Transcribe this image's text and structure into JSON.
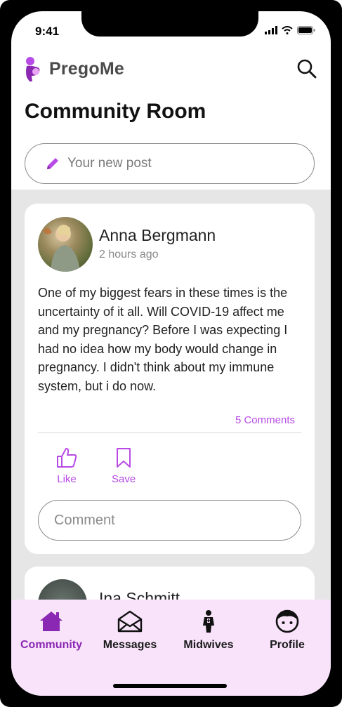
{
  "status_bar": {
    "time": "9:41"
  },
  "app": {
    "name": "PregoMe"
  },
  "page": {
    "title": "Community Room"
  },
  "composer": {
    "placeholder": "Your new post"
  },
  "posts": [
    {
      "author": "Anna Bergmann",
      "time": "2 hours ago",
      "body": "One of my biggest fears in these times is the uncertainty of it all. Will COVID-19 affect me and my pregnancy? Before I was expecting I had no idea how my body would change in pregnancy. I didn't think about my immune system, but i do now.",
      "comments": "5 Comments",
      "like_label": "Like",
      "save_label": "Save",
      "comment_placeholder": "Comment"
    },
    {
      "author": "Ina Schmitt"
    }
  ],
  "tabs": [
    {
      "label": "Community",
      "icon": "home-icon",
      "active": true
    },
    {
      "label": "Messages",
      "icon": "envelope-icon",
      "active": false
    },
    {
      "label": "Midwives",
      "icon": "midwife-icon",
      "active": false
    },
    {
      "label": "Profile",
      "icon": "face-icon",
      "active": false
    }
  ],
  "colors": {
    "accent": "#b84be6",
    "active_tab": "#8a27b3",
    "tabbar_bg": "#f9e3fb",
    "feed_bg": "#e6e6e6"
  }
}
